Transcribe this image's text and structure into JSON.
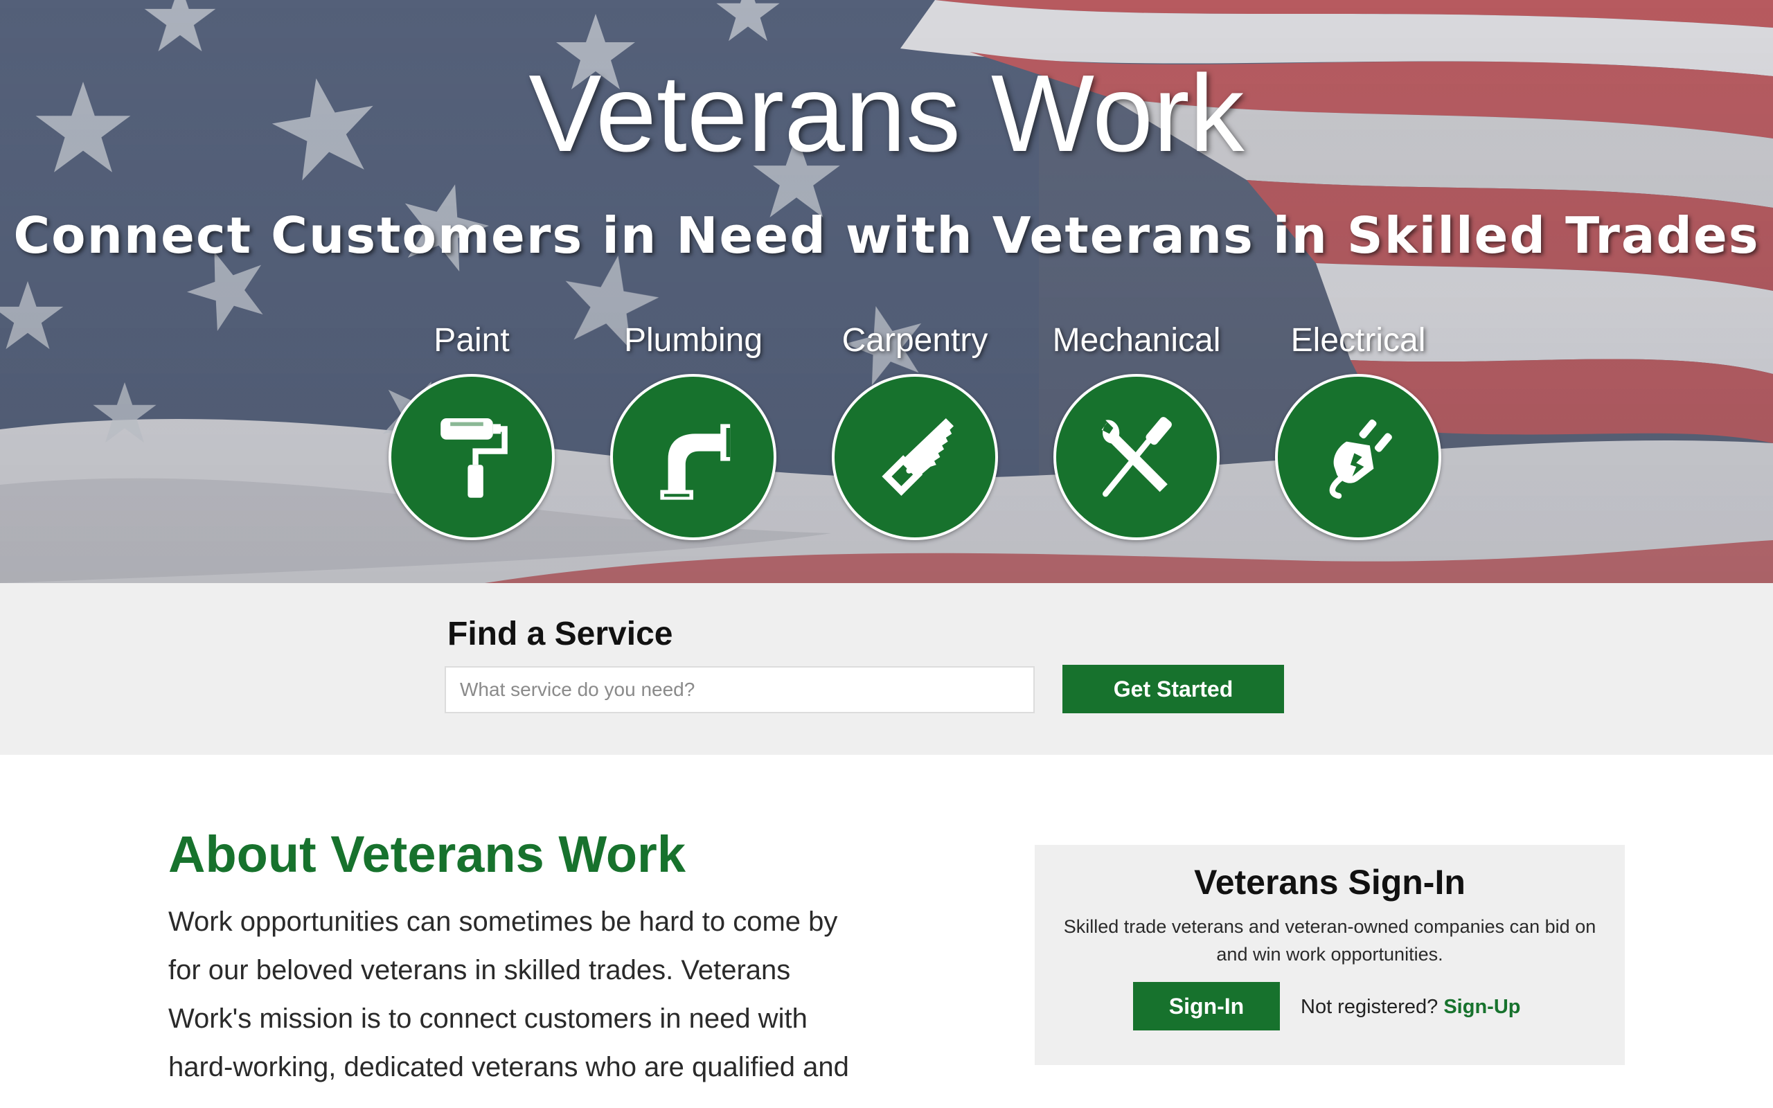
{
  "hero": {
    "title": "Veterans Work",
    "subtitle": "Connect Customers in Need with Veterans in Skilled Trades",
    "services": [
      {
        "label": "Paint",
        "icon": "paint-roller-icon"
      },
      {
        "label": "Plumbing",
        "icon": "pipe-elbow-icon"
      },
      {
        "label": "Carpentry",
        "icon": "saw-icon"
      },
      {
        "label": "Mechanical",
        "icon": "wrench-screwdriver-icon"
      },
      {
        "label": "Electrical",
        "icon": "electric-plug-icon"
      }
    ]
  },
  "search": {
    "heading": "Find a Service",
    "placeholder": "What service do you need?",
    "button_label": "Get Started"
  },
  "about": {
    "title": "About Veterans Work",
    "text": "Work opportunities can sometimes be hard to come by for our beloved veterans in skilled trades. Veterans Work's mission is to connect customers in need with hard-working, dedicated veterans who are qualified and"
  },
  "signin": {
    "title": "Veterans Sign-In",
    "description": "Skilled trade veterans and veteran-owned companies can bid on and win work opportunities.",
    "button_label": "Sign-In",
    "not_registered": "Not registered?",
    "signup_label": "Sign-Up"
  },
  "colors": {
    "brand_green": "#17722d",
    "band_gray": "#efefef"
  }
}
